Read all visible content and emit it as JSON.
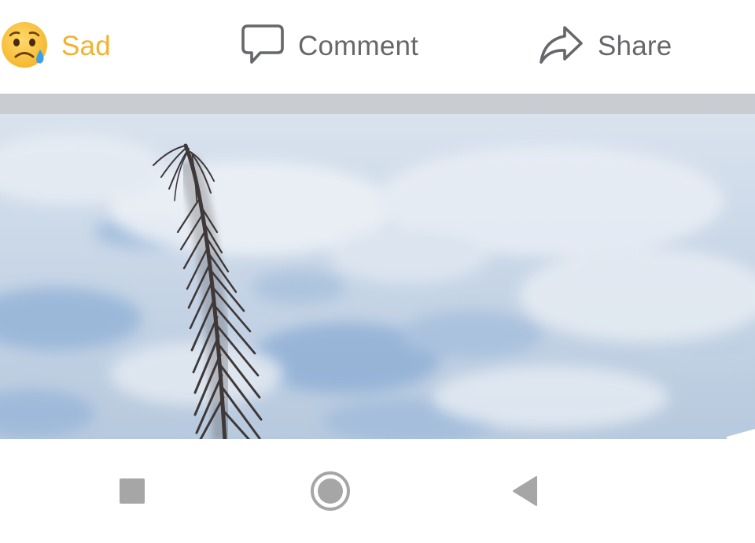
{
  "actions": {
    "reaction": {
      "label": "Sad",
      "icon": "sad-face-emoji-icon",
      "color": "#f4b12e"
    },
    "comment": {
      "label": "Comment",
      "icon": "comment-bubble-icon"
    },
    "share": {
      "label": "Share",
      "icon": "share-arrow-icon"
    }
  },
  "post": {
    "image": {
      "subject": "palm frond against cloudy blue sky"
    }
  },
  "system_nav": {
    "recents": {
      "icon": "square-recents-icon"
    },
    "home": {
      "icon": "circle-home-icon"
    },
    "back": {
      "icon": "triangle-back-icon"
    }
  },
  "colors": {
    "reaction_active": "#f4b12e",
    "action_text": "#65676b",
    "divider": "#c9ccd1",
    "nav_icon": "#a6a6a6"
  }
}
